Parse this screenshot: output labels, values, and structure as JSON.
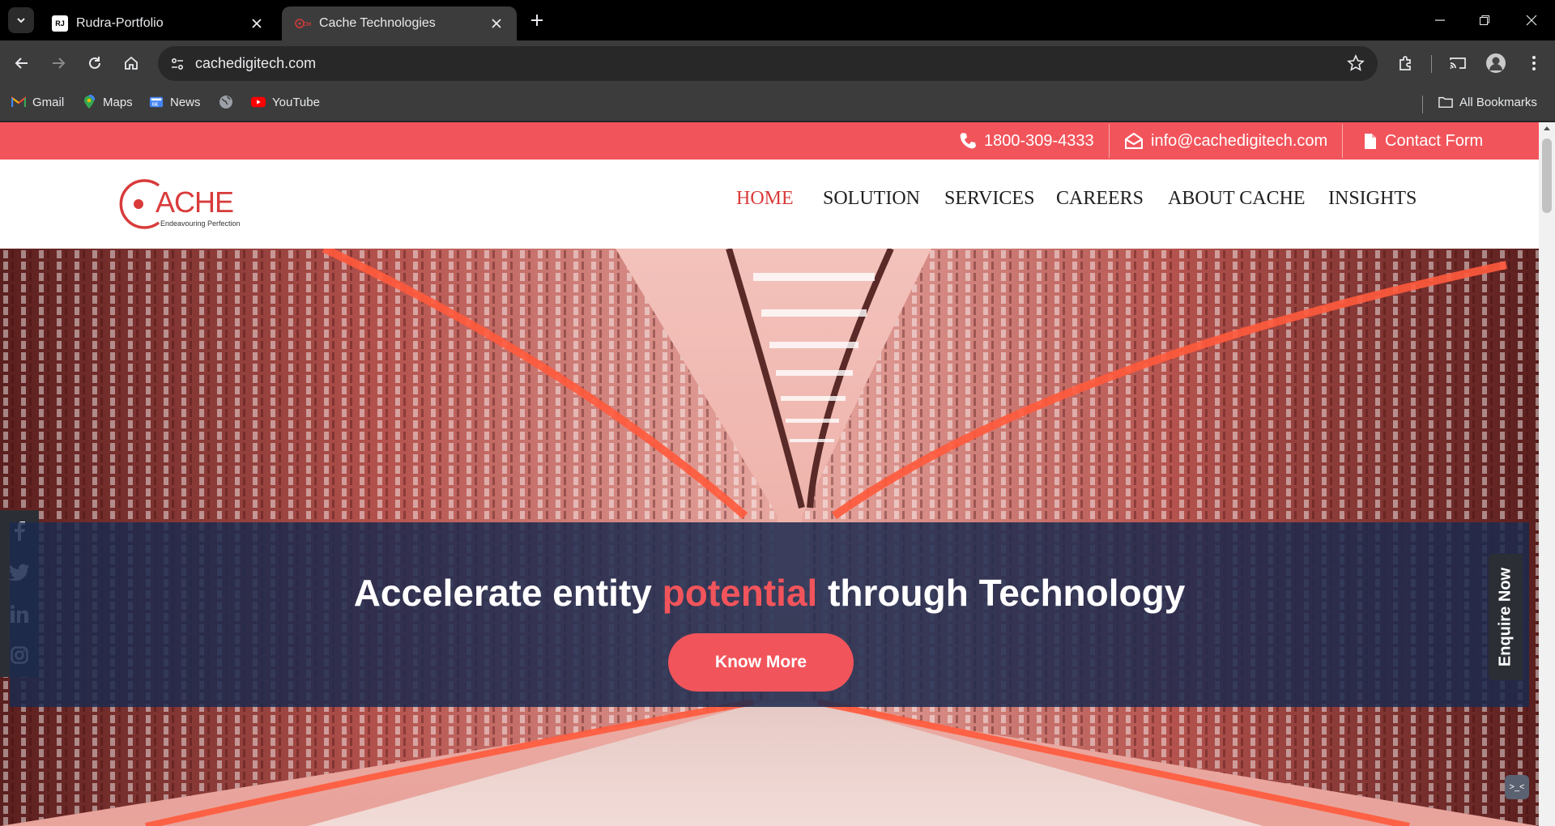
{
  "browser": {
    "tabs": [
      {
        "title": "Rudra-Portfolio",
        "favicon": "RJ",
        "active": false
      },
      {
        "title": "Cache Technologies",
        "favicon": "cache-logo",
        "active": true
      }
    ],
    "url": "cachedigitech.com",
    "bookmarks": [
      {
        "label": "Gmail",
        "icon": "gmail-icon"
      },
      {
        "label": "Maps",
        "icon": "maps-icon"
      },
      {
        "label": "News",
        "icon": "news-icon"
      },
      {
        "label": "",
        "icon": "globe-icon"
      },
      {
        "label": "YouTube",
        "icon": "youtube-icon"
      }
    ],
    "all_bookmarks_label": "All Bookmarks"
  },
  "topbar": {
    "phone": "1800-309-4333",
    "email": "info@cachedigitech.com",
    "contact": "Contact Form",
    "color": "#f2545b"
  },
  "header": {
    "logo_text": "ACHE",
    "logo_tagline": "Endeavouring Perfection",
    "nav": [
      {
        "label": "HOME",
        "active": true
      },
      {
        "label": "SOLUTION",
        "active": false
      },
      {
        "label": "SERVICES",
        "active": false
      },
      {
        "label": "CAREERS",
        "active": false
      },
      {
        "label": "ABOUT CACHE",
        "active": false
      },
      {
        "label": "INSIGHTS",
        "active": false
      }
    ]
  },
  "hero": {
    "title_pre": "Accelerate entity ",
    "title_accent": "potential",
    "title_post": " through Technology",
    "cta": "Know More"
  },
  "social": [
    "facebook-icon",
    "twitter-icon",
    "linkedin-icon",
    "instagram-icon"
  ],
  "enquire": "Enquire Now",
  "chat": ">_<"
}
